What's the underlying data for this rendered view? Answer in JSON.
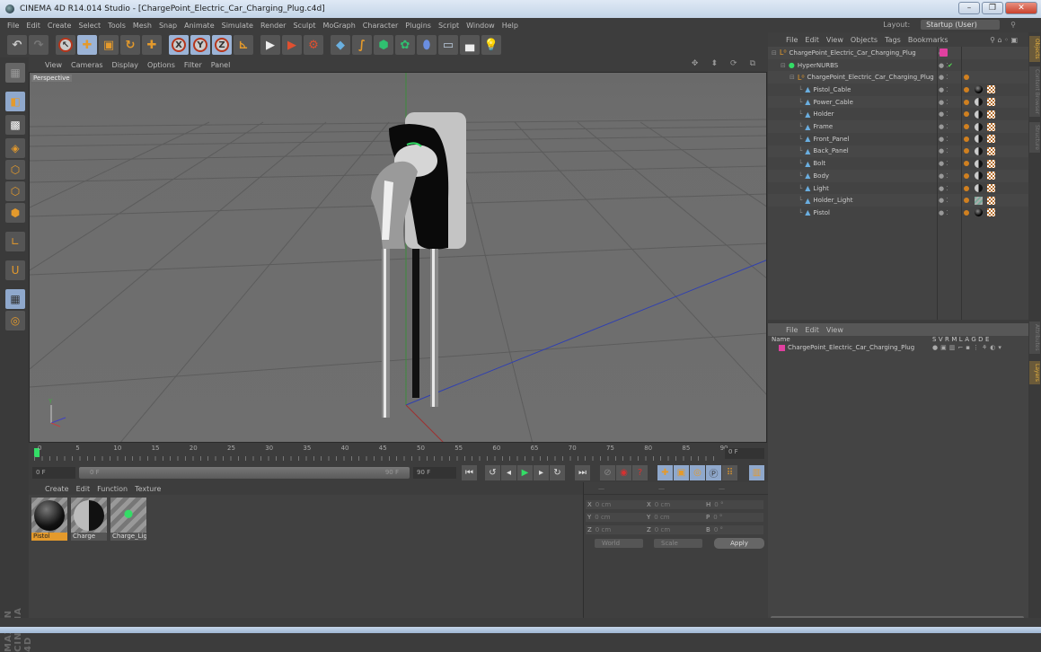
{
  "window": {
    "title": "CINEMA 4D R14.014 Studio - [ChargePoint_Electric_Car_Charging_Plug.c4d]",
    "minimize": "–",
    "restore": "❐",
    "close": "✕"
  },
  "menubar": {
    "items": [
      "File",
      "Edit",
      "Create",
      "Select",
      "Tools",
      "Mesh",
      "Snap",
      "Animate",
      "Simulate",
      "Render",
      "Sculpt",
      "MoGraph",
      "Character",
      "Plugins",
      "Script",
      "Window",
      "Help"
    ],
    "layout_label": "Layout:",
    "layout_value": "Startup (User)"
  },
  "toolbar": {
    "icons": [
      "undo-icon",
      "redo-icon",
      "live-selection-icon",
      "move-icon",
      "scale-icon",
      "rotate-icon",
      "recent-tool-icon",
      "x-axis-icon",
      "y-axis-icon",
      "z-axis-icon",
      "coordinate-system-icon",
      "render-view-icon",
      "render-picture-viewer-icon",
      "edit-render-settings-icon",
      "cube-primitive-icon",
      "spline-icon",
      "nurbs-icon",
      "array-icon",
      "deformer-icon",
      "floor-icon",
      "camera-icon",
      "light-icon"
    ],
    "axis_labels": [
      "X",
      "Y",
      "Z"
    ]
  },
  "left_tools": [
    "make-editable-icon",
    "model-mode-icon",
    "texture-mode-icon",
    "workplane-icon",
    "points-mode-icon",
    "edges-mode-icon",
    "polygons-mode-icon",
    "axis-mode-icon",
    "tweak-magnet-icon",
    "workplane-lock-icon",
    "snap-icon"
  ],
  "branding": "MAXON CINEMA 4D",
  "viewport": {
    "menu": [
      "View",
      "Cameras",
      "Display",
      "Options",
      "Filter",
      "Panel"
    ],
    "label": "Perspective",
    "nav_icons": [
      "move-view-icon",
      "zoom-view-icon",
      "rotate-view-icon",
      "maximize-view-icon"
    ],
    "axis_y": "Y"
  },
  "timeline": {
    "ticks": [
      "0",
      "5",
      "10",
      "15",
      "20",
      "25",
      "30",
      "35",
      "40",
      "45",
      "50",
      "55",
      "60",
      "65",
      "70",
      "75",
      "80",
      "85",
      "90"
    ],
    "current_frame": "0 F",
    "start_field": "0 F",
    "slider_start": "0 F",
    "slider_end": "90 F",
    "end_field": "90 F"
  },
  "transport": {
    "buttons": [
      "go-to-start",
      "step-back-keyframe",
      "step-back",
      "play",
      "step-forward",
      "step-forward-keyframe",
      "go-to-end",
      "autokey",
      "record",
      "keyframe-selection",
      "move-key",
      "scale-key",
      "rotate-key",
      "param-key",
      "pla-key",
      "timeline-window"
    ]
  },
  "materials": {
    "menu": [
      "Create",
      "Edit",
      "Function",
      "Texture"
    ],
    "items": [
      {
        "name": "Pistol",
        "selected": true,
        "style": "black-glossy"
      },
      {
        "name": "Charge",
        "selected": false,
        "style": "grey-black-split"
      },
      {
        "name": "Charge_Lig",
        "selected": false,
        "style": "green-light"
      }
    ]
  },
  "coordinates": {
    "header": [
      "—",
      "—",
      "—"
    ],
    "rows": [
      {
        "a": "X",
        "av": "0 cm",
        "b": "X",
        "bv": "0 cm",
        "c": "H",
        "cv": "0 °"
      },
      {
        "a": "Y",
        "av": "0 cm",
        "b": "Y",
        "bv": "0 cm",
        "c": "P",
        "cv": "0 °"
      },
      {
        "a": "Z",
        "av": "0 cm",
        "b": "Z",
        "bv": "0 cm",
        "c": "B",
        "cv": "0 °"
      }
    ],
    "mode": "World",
    "size_mode": "Scale",
    "apply": "Apply"
  },
  "objects": {
    "menu": [
      "File",
      "Edit",
      "View",
      "Objects",
      "Tags",
      "Bookmarks"
    ],
    "tree": [
      {
        "name": "ChargePoint_Electric_Car_Charging_Plug",
        "indent": 0,
        "type": "null",
        "tags": "layer"
      },
      {
        "name": "HyperNURBS",
        "indent": 1,
        "type": "hypernurbs",
        "tags": "check"
      },
      {
        "name": "ChargePoint_Electric_Car_Charging_Plug",
        "indent": 2,
        "type": "null",
        "tags": "phong"
      },
      {
        "name": "Pistol_Cable",
        "indent": 3,
        "type": "polygon",
        "tags": "black"
      },
      {
        "name": "Power_Cable",
        "indent": 3,
        "type": "polygon",
        "tags": "split"
      },
      {
        "name": "Holder",
        "indent": 3,
        "type": "polygon",
        "tags": "split"
      },
      {
        "name": "Frame",
        "indent": 3,
        "type": "polygon",
        "tags": "split"
      },
      {
        "name": "Front_Panel",
        "indent": 3,
        "type": "polygon",
        "tags": "split"
      },
      {
        "name": "Back_Panel",
        "indent": 3,
        "type": "polygon",
        "tags": "split"
      },
      {
        "name": "Bolt",
        "indent": 3,
        "type": "polygon",
        "tags": "split"
      },
      {
        "name": "Body",
        "indent": 3,
        "type": "polygon",
        "tags": "split"
      },
      {
        "name": "Light",
        "indent": 3,
        "type": "polygon",
        "tags": "split"
      },
      {
        "name": "Holder_Light",
        "indent": 3,
        "type": "polygon",
        "tags": "green"
      },
      {
        "name": "Pistol",
        "indent": 3,
        "type": "polygon",
        "tags": "black"
      }
    ]
  },
  "side_tabs": [
    "Objects",
    "Content Browser",
    "Structure",
    "Attributes",
    "Layers"
  ],
  "layers": {
    "menu": [
      "File",
      "Edit",
      "View"
    ],
    "name_header": "Name",
    "columns": [
      "S",
      "V",
      "R",
      "M",
      "L",
      "A",
      "G",
      "D",
      "E"
    ],
    "rows": [
      {
        "name": "ChargePoint_Electric_Car_Charging_Plug",
        "color": "#e040a0"
      }
    ]
  },
  "colors": {
    "accent": "#e49a2c",
    "selection_blue": "#8fa8cc",
    "layer_pink": "#e040a0",
    "green_frame": "#33dd66"
  }
}
